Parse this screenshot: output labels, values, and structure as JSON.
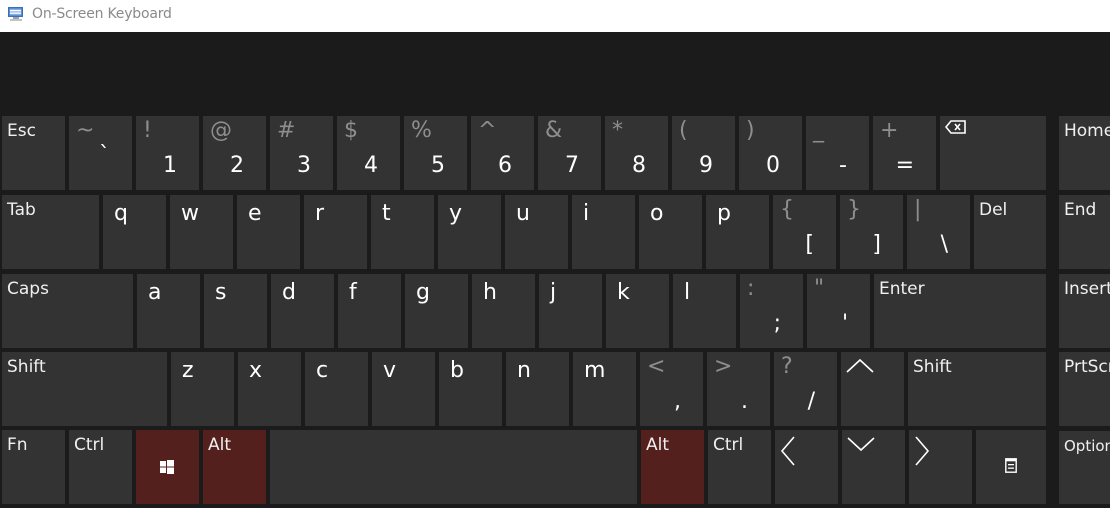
{
  "window": {
    "title": "On-Screen Keyboard",
    "icon": "osk-app-icon"
  },
  "colors": {
    "key": "#333333",
    "background": "#1b1b1b",
    "active_modifier": "#54201e",
    "shift_symbol": "#8e8e8e"
  },
  "rows": {
    "row1": {
      "esc": "Esc",
      "backtick": {
        "shift": "~",
        "main": "`"
      },
      "k1": {
        "shift": "!",
        "main": "1"
      },
      "k2": {
        "shift": "@",
        "main": "2"
      },
      "k3": {
        "shift": "#",
        "main": "3"
      },
      "k4": {
        "shift": "$",
        "main": "4"
      },
      "k5": {
        "shift": "%",
        "main": "5"
      },
      "k6": {
        "shift": "^",
        "main": "6"
      },
      "k7": {
        "shift": "&",
        "main": "7"
      },
      "k8": {
        "shift": "*",
        "main": "8"
      },
      "k9": {
        "shift": "(",
        "main": "9"
      },
      "k0": {
        "shift": ")",
        "main": "0"
      },
      "minus": {
        "shift": "_",
        "main": "-"
      },
      "equals": {
        "shift": "+",
        "main": "="
      },
      "backspace": "backspace-icon",
      "home": "Home"
    },
    "row2": {
      "tab": "Tab",
      "letters": [
        "q",
        "w",
        "e",
        "r",
        "t",
        "y",
        "u",
        "i",
        "o",
        "p"
      ],
      "lbracket": {
        "shift": "{",
        "main": "["
      },
      "rbracket": {
        "shift": "}",
        "main": "]"
      },
      "backslash": {
        "shift": "|",
        "main": "\\"
      },
      "del": "Del",
      "end": "End"
    },
    "row3": {
      "caps": "Caps",
      "letters": [
        "a",
        "s",
        "d",
        "f",
        "g",
        "h",
        "j",
        "k",
        "l"
      ],
      "semicolon": {
        "shift": ":",
        "main": ";"
      },
      "quote": {
        "shift": "\"",
        "main": "'"
      },
      "enter": "Enter",
      "insert": "Insert"
    },
    "row4": {
      "shift_left": "Shift",
      "letters": [
        "z",
        "x",
        "c",
        "v",
        "b",
        "n",
        "m"
      ],
      "comma": {
        "shift": "<",
        "main": ","
      },
      "period": {
        "shift": ">",
        "main": "."
      },
      "slash": {
        "shift": "?",
        "main": "/"
      },
      "up": "up-arrow-icon",
      "shift_right": "Shift",
      "prtscn": "PrtScn"
    },
    "row5": {
      "fn": "Fn",
      "ctrl_left": "Ctrl",
      "win": "windows-icon",
      "alt_left": "Alt",
      "space": "",
      "alt_right": "Alt",
      "ctrl_right": "Ctrl",
      "left": "left-arrow-icon",
      "down": "down-arrow-icon",
      "right": "right-arrow-icon",
      "menu": "menu-key-icon",
      "options": "Options"
    }
  },
  "active_keys": [
    "win",
    "alt_left",
    "alt_right"
  ]
}
